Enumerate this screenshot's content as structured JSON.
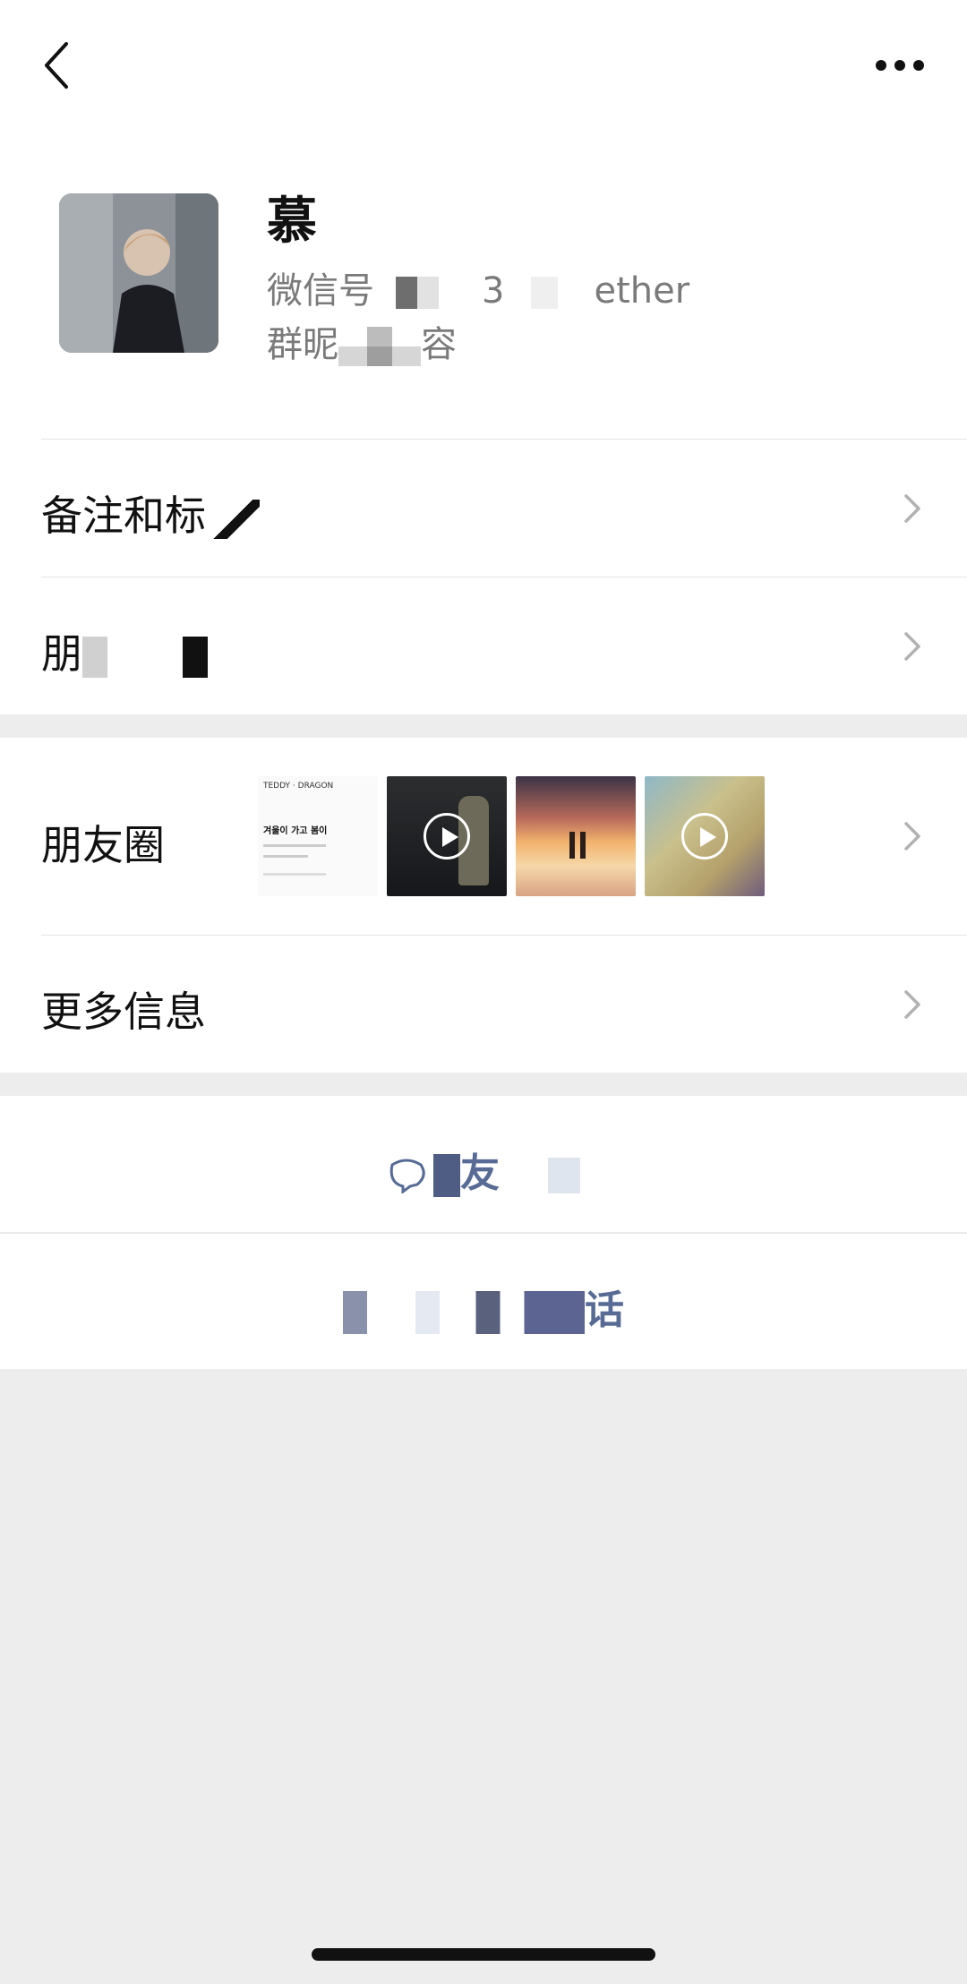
{
  "header": {
    "back_icon": "chevron-left-icon",
    "more_icon": "more-horizontal-icon"
  },
  "profile": {
    "name": "慕",
    "wechat_id_prefix": "微信号",
    "wechat_id_partial": "3",
    "wechat_id_suffix": "ether",
    "group_nickname_prefix": "群昵",
    "group_nickname_suffix": "容"
  },
  "rows": {
    "remarks_label": "备注和标",
    "friend_perms_label": "朋",
    "moments_label": "朋友圈",
    "more_info_label": "更多信息"
  },
  "moments": {
    "thumb1_brand": "TEDDY",
    "thumb1_brand2": "DRAGON",
    "thumb1_text": "겨울이 가고 봄이"
  },
  "actions": {
    "send_message_partial": "友",
    "call_partial": "话"
  },
  "colors": {
    "link_blue": "#576b95",
    "background": "#ededed",
    "white": "#ffffff"
  }
}
